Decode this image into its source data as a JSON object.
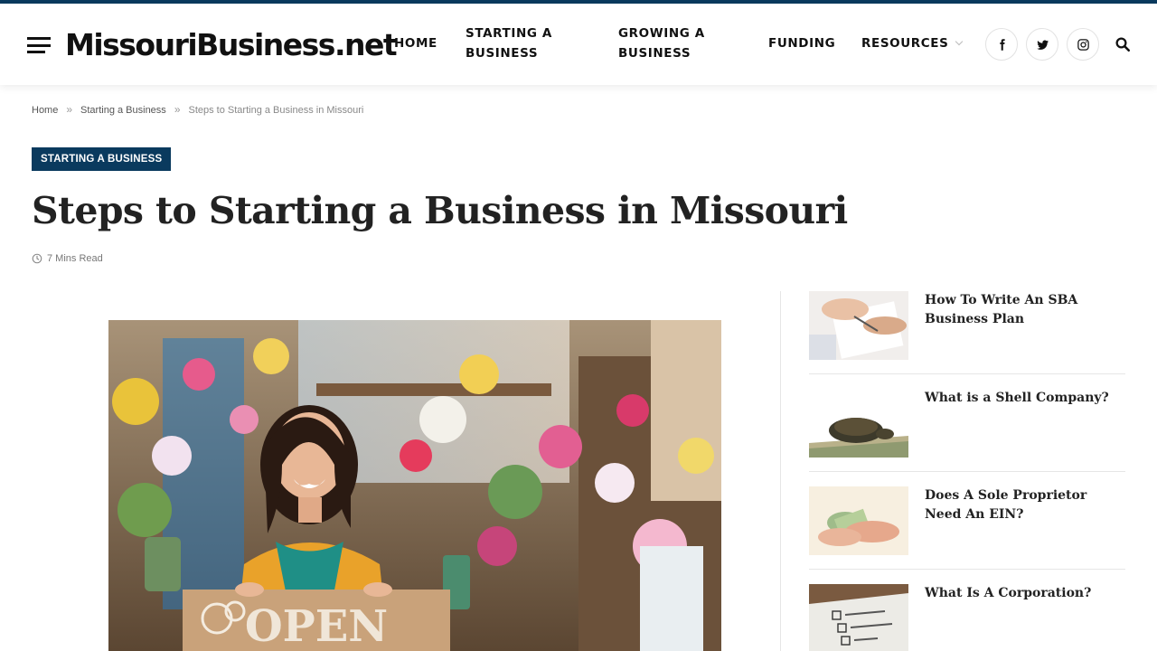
{
  "site": {
    "logo": "MissouriBusiness.net",
    "accent_color": "#0a3a5e"
  },
  "nav": {
    "items": [
      {
        "label": "HOME"
      },
      {
        "label": "STARTING A BUSINESS"
      },
      {
        "label": "GROWING A BUSINESS"
      },
      {
        "label": "FUNDING"
      },
      {
        "label": "RESOURCES",
        "icon": "chevron-down-icon"
      }
    ],
    "social": [
      {
        "icon": "facebook-icon"
      },
      {
        "icon": "twitter-icon"
      },
      {
        "icon": "instagram-icon"
      }
    ],
    "search_icon": "search-icon"
  },
  "breadcrumb": {
    "items": [
      "Home",
      "Starting a Business",
      "Steps to Starting a Business in Missouri"
    ],
    "separator": "»"
  },
  "post": {
    "category": "STARTING A BUSINESS",
    "title": "Steps to Starting a Business in Missouri",
    "read_time": "7 Mins Read",
    "featured_image": "Woman in a flower shop holding an OPEN sign"
  },
  "sidebar": {
    "posts": [
      {
        "title": "How To Write An SBA Business Plan",
        "thumb": "people-signing-documents"
      },
      {
        "title": "What is a Shell Company?",
        "thumb": "turtle-on-dollar-bills"
      },
      {
        "title": "Does A Sole Proprietor Need An EIN?",
        "thumb": "hands-counting-cash"
      },
      {
        "title": "What Is A Corporation?",
        "thumb": "business-type-checklist"
      }
    ]
  }
}
